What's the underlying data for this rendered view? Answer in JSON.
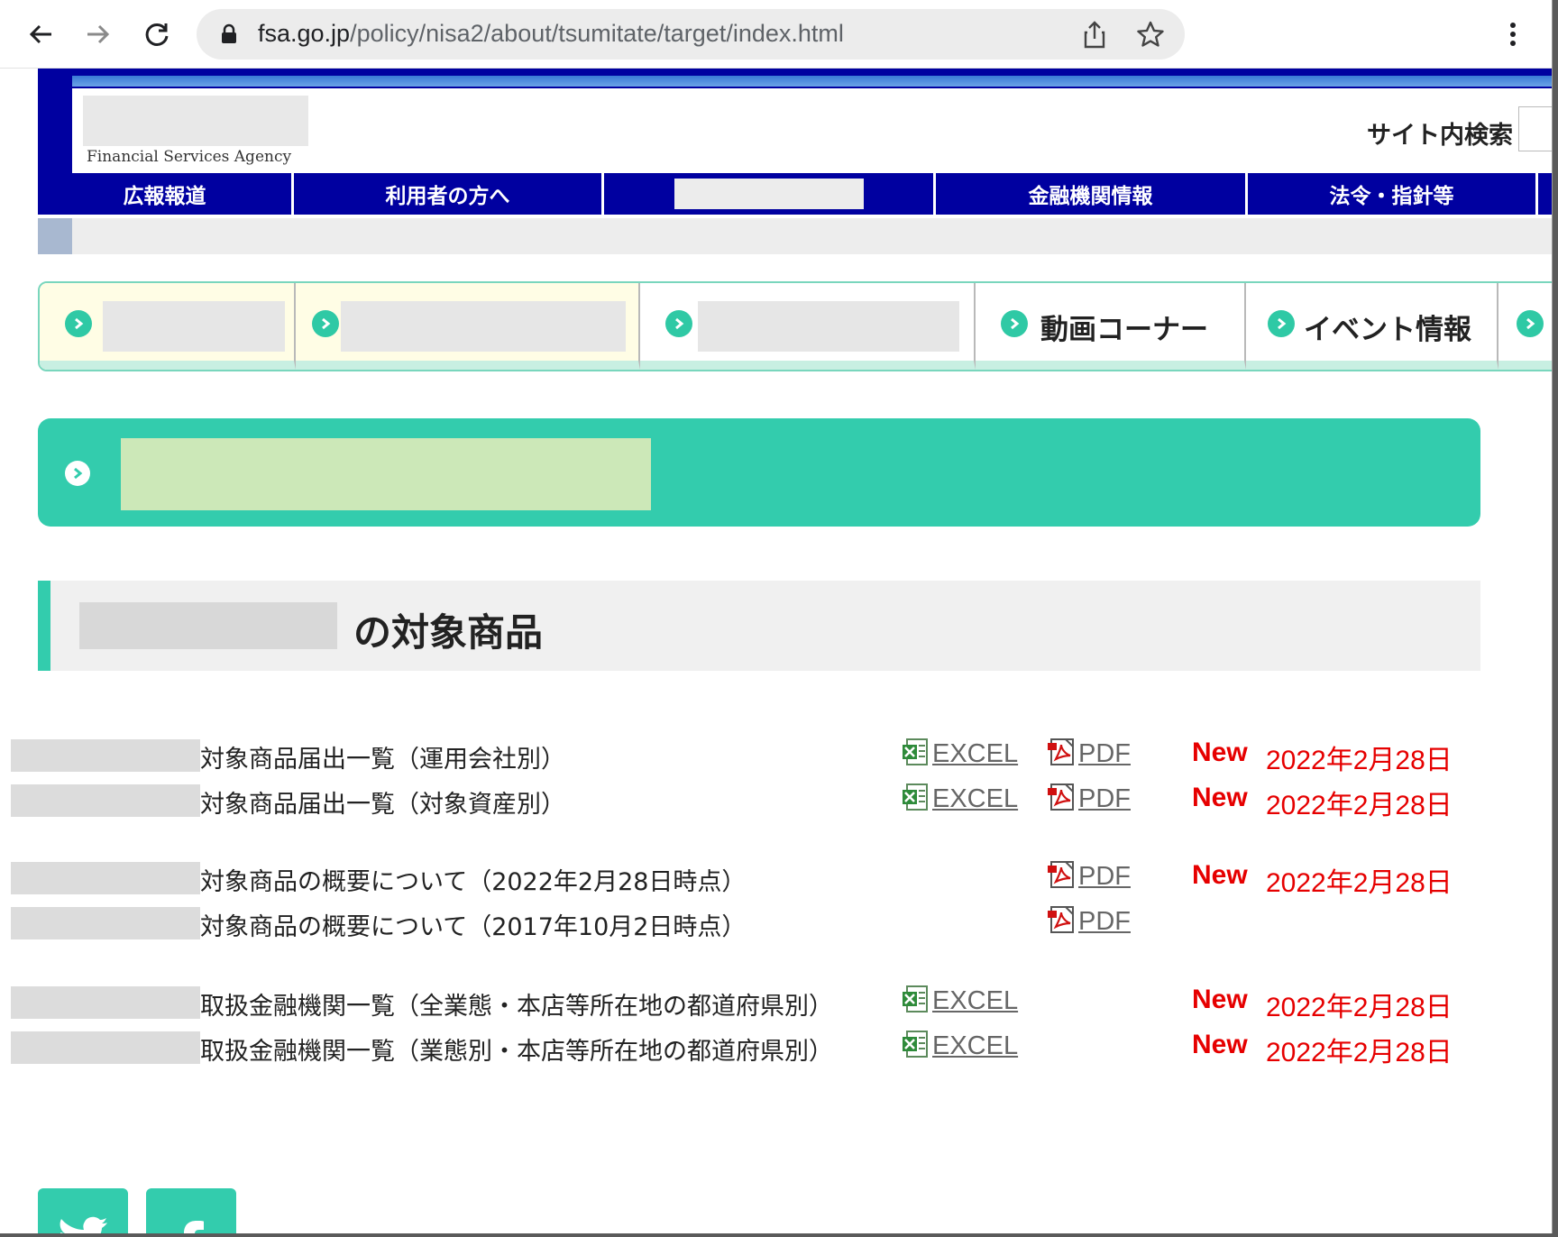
{
  "browser": {
    "url_host": "fsa.go.jp",
    "url_path": "/policy/nisa2/about/tsumitate/target/index.html"
  },
  "header": {
    "agency_name": "Financial Services Agency",
    "search_label": "サイト内検索"
  },
  "global_nav": {
    "items": [
      "広報報道",
      "利用者の方へ",
      "",
      "金融機関情報",
      "法令・指針等"
    ]
  },
  "sub_tabs": {
    "items": [
      "",
      "",
      "",
      "動画コーナー",
      "イベント情報",
      ""
    ]
  },
  "section": {
    "title": "の対象商品"
  },
  "files": {
    "new_label": "New",
    "excel_label": "EXCEL",
    "pdf_label": "PDF",
    "rows": [
      {
        "title": "対象商品届出一覧（運用会社別）",
        "excel": true,
        "pdf": true,
        "is_new": true,
        "date": "2022年2月28日"
      },
      {
        "title": "対象商品届出一覧（対象資産別）",
        "excel": true,
        "pdf": true,
        "is_new": true,
        "date": "2022年2月28日"
      },
      {
        "title": "対象商品の概要について（2022年2月28日時点）",
        "excel": false,
        "pdf": true,
        "is_new": true,
        "date": "2022年2月28日"
      },
      {
        "title": "対象商品の概要について（2017年10月2日時点）",
        "excel": false,
        "pdf": true,
        "is_new": false,
        "date": ""
      },
      {
        "title": "取扱金融機関一覧（全業態・本店等所在地の都道府県別）",
        "excel": true,
        "pdf": false,
        "is_new": true,
        "date": "2022年2月28日"
      },
      {
        "title": "取扱金融機関一覧（業態別・本店等所在地の都道府県別）",
        "excel": true,
        "pdf": false,
        "is_new": true,
        "date": "2022年2月28日"
      }
    ]
  },
  "colors": {
    "nav_blue": "#0000a0",
    "accent_green": "#33ccad",
    "new_red": "#e60000"
  }
}
